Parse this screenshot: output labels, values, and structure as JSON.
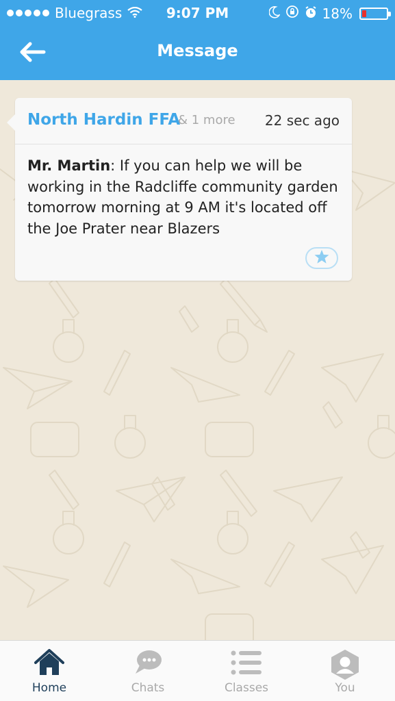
{
  "status_bar": {
    "carrier": "Bluegrass",
    "time": "9:07 PM",
    "battery": "18%",
    "battery_level": 0.18,
    "signal_bars": 5
  },
  "nav": {
    "title": "Message",
    "back_icon": "arrow-left-icon"
  },
  "message": {
    "sender": "North Hardin FFA",
    "more": "& 1 more",
    "time_ago": "22 sec ago",
    "author": "Mr. Martin",
    "text": ": If you can help we will be working in the Radcliffe community garden tomorrow morning at 9 AM it's located off the Joe Prater near Blazers",
    "star_icon": "star-icon"
  },
  "tabs": [
    {
      "label": "Home",
      "icon": "home-icon",
      "active": true
    },
    {
      "label": "Chats",
      "icon": "chat-bubble-icon",
      "active": false
    },
    {
      "label": "Classes",
      "icon": "list-icon",
      "active": false
    },
    {
      "label": "You",
      "icon": "user-icon",
      "active": false
    }
  ],
  "colors": {
    "header": "#3fa6e8",
    "background": "#efe8da",
    "active_tab": "#1f3f5a",
    "inactive_tab": "#a9a9a9",
    "battery_low": "#e8302c"
  }
}
